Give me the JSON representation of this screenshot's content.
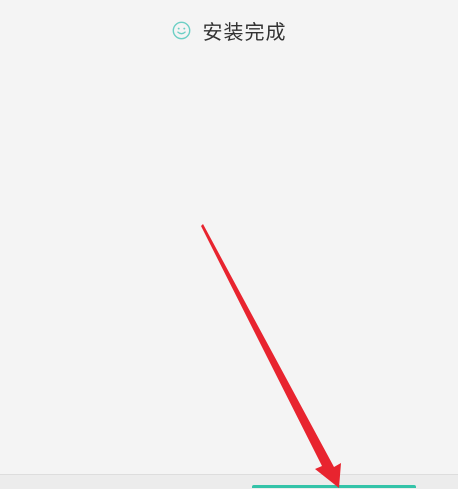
{
  "install_status": {
    "icon": "smile-icon",
    "text": "安装完成",
    "icon_color": "#6ccfc5",
    "text_color": "#333333"
  },
  "bottom_bar": {
    "button_color": "#34c3a8"
  },
  "overlay": {
    "arrow_color": "#e8242f"
  },
  "colors": {
    "background": "#f4f4f4"
  }
}
